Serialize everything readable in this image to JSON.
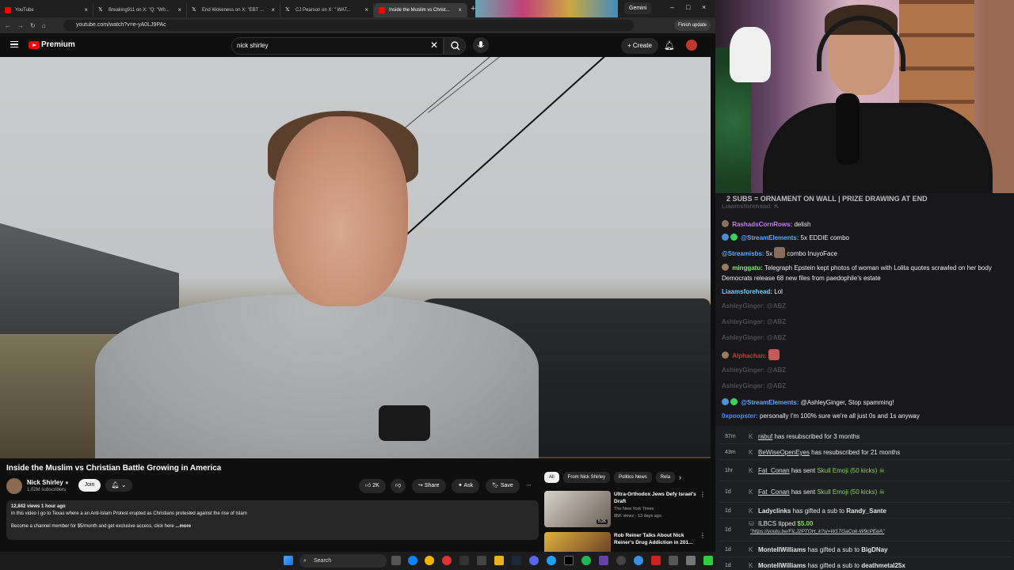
{
  "browser": {
    "tabs": [
      {
        "label": "YouTube",
        "color": "#ff0000"
      },
      {
        "label": "Breaking911 on X: \"Q: \"Wh...",
        "color": "#ffffff"
      },
      {
        "label": "End Wokeness on X: \"EBT ...",
        "color": "#ffffff"
      },
      {
        "label": "CJ Pearson on X: \" WAT...",
        "color": "#ffffff"
      },
      {
        "label": "Inside the Muslim vs Christ...",
        "color": "#ff0000"
      }
    ],
    "gemini_label": "Gemini",
    "url": "youtube.com/watch?v=e-yA0LJ9PAc",
    "finish_update": "Finish update"
  },
  "youtube": {
    "brand": "Premium",
    "search_value": "nick shirley",
    "create_label": "Create",
    "video": {
      "title": "Inside the Muslim vs Christian Battle Growing in America",
      "channel": "Nick Shirley",
      "subscribers": "1.02M subscribers",
      "join_label": "Join",
      "like_count": "2K",
      "share_label": "Share",
      "ask_label": "Ask",
      "save_label": "Save",
      "stats": "12,842 views  1 hour ago",
      "description_line1": "In this video I go to Texas where a an Anti-Islam Protest erupted as Christians protested against the rise of Islam",
      "description_line2": "Become a channel member for $5/month and get exclusive access, click here",
      "more_label": "...more"
    },
    "chips": [
      "All",
      "From Nick Shirley",
      "Politics News",
      "Rela"
    ],
    "recommendations": [
      {
        "title": "Ultra-Orthodox Jews Defy Israel's Draft",
        "channel": "The New York Times",
        "meta": "85K views · 13 days ago",
        "duration": "5:26"
      },
      {
        "title": "Rob Reiner Talks About Nick Reiner's Drug Addiction in 201...",
        "channel": "",
        "meta": "",
        "duration": ""
      }
    ]
  },
  "taskbar": {
    "search_label": "Search"
  },
  "stream": {
    "marquee": "2 SUBS = ORNAMENT ON WALL | PRIZE DRAWING AT END",
    "chat": [
      {
        "user": "RashadsCornRows:",
        "user_color": "#c07cf5",
        "text": "delish"
      },
      {
        "user": "@StreamElements:",
        "user_color": "#5aa7ff",
        "text": "5x EDDIE combo"
      },
      {
        "user": "@Streamisbs:",
        "user_color": "#5aa7ff",
        "text_a": "5x",
        "text_b": "combo InuyoFace"
      },
      {
        "user": "minggatu:",
        "user_color": "#7cf06b",
        "text": "Telegraph Epstein kept photos of woman with Lolita quotes scrawled on her body Democrats release 68 new files from paedophile's estate"
      },
      {
        "user": "Liaamsforehead:",
        "user_color": "#6ecbf5",
        "text": "Lol"
      },
      {
        "user": "AshleyGinger:",
        "text": "@ABZ"
      },
      {
        "user": "AshleyGinger:",
        "text": "@ABZ"
      },
      {
        "user": "AshleyGinger:",
        "text": "@ABZ"
      },
      {
        "user": "Alphachan:",
        "user_color": "#ff4d4d"
      },
      {
        "user": "AshleyGinger:",
        "text": "@ABZ"
      },
      {
        "user": "AshleyGinger:",
        "text": "@ABZ"
      },
      {
        "user": "@StreamElements:",
        "user_color": "#5aa7ff",
        "text": "@AshleyGinger, Stop spamming!"
      },
      {
        "user": "0xpoopster:",
        "user_color": "#4d8cff",
        "text": "personally I'm 100% sure we're all just 0s and 1s anyway"
      }
    ],
    "events": [
      {
        "time": "37m",
        "name": "rabuf",
        "text": "has resubscribed for 3 months"
      },
      {
        "time": "43m",
        "name": "BeWiseOpenEyes",
        "text": "has resubscribed for 21 months"
      },
      {
        "time": "1hr",
        "name": "Fat_Conan",
        "text": "has sent",
        "gift": "Skull Emoji (50 kicks)"
      },
      {
        "time": "1d",
        "name": "Fat_Conan",
        "text": "has sent",
        "gift": "Skull Emoji (50 kicks)"
      },
      {
        "time": "1d",
        "name": "Ladyclinks",
        "text": "has gifted a sub to",
        "target": "Randy_Sante"
      },
      {
        "time": "1d",
        "name": "ILBCS",
        "text": "tipped",
        "amount": "$5.00",
        "link": "\"https://youtu.be/FiLJ2PTOH_k?si=W1TGaCok-W9cPEeA\""
      },
      {
        "time": "1d",
        "name": "MontellWilliams",
        "text": "has gifted a sub to",
        "target": "BigDNay"
      },
      {
        "time": "1d",
        "name": "MontellWilliams",
        "text": "has gifted a sub to",
        "target": "deathmetal25x"
      }
    ]
  },
  "colors": {
    "accent": "#ff0000",
    "chat_bg": "#18181b",
    "gift_green": "#7cd957"
  }
}
